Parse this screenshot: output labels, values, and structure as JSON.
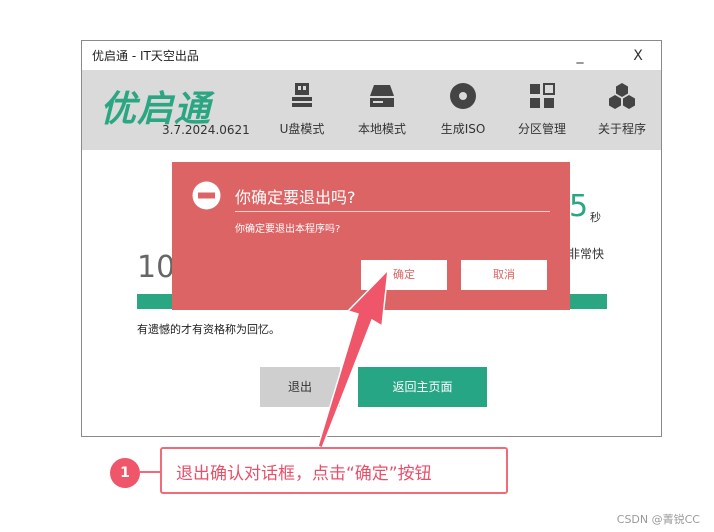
{
  "window": {
    "title": "优启通 - IT天空出品",
    "minimize_label": "_",
    "close_label": "X"
  },
  "header": {
    "logo_text": "优启通",
    "version": "3.7.2024.0621",
    "nav": [
      {
        "label": "U盘模式",
        "icon": "usb-drive-icon"
      },
      {
        "label": "本地模式",
        "icon": "hard-disk-icon"
      },
      {
        "label": "生成ISO",
        "icon": "disc-icon"
      },
      {
        "label": "分区管理",
        "icon": "partition-grid-icon"
      },
      {
        "label": "关于程序",
        "icon": "hexagon-cluster-icon"
      }
    ]
  },
  "content": {
    "left_number": "10",
    "right_number": "5",
    "seconds_label": "秒",
    "speed_text": "非常快",
    "message": "有遗憾的才有资格称为回忆。",
    "exit_button": "退出",
    "home_button": "返回主页面"
  },
  "dialog": {
    "title": "你确定要退出吗?",
    "message": "你确定要退出本程序吗?",
    "ok_label": "确定",
    "cancel_label": "取消"
  },
  "annotation": {
    "step_number": "1",
    "text": "退出确认对话框，点击“确定”按钮"
  },
  "watermark": "CSDN @菁锐CC",
  "colors": {
    "brand_green": "#2aa682",
    "dialog_red": "#dc6464",
    "annotation_pink": "#f06a78"
  }
}
